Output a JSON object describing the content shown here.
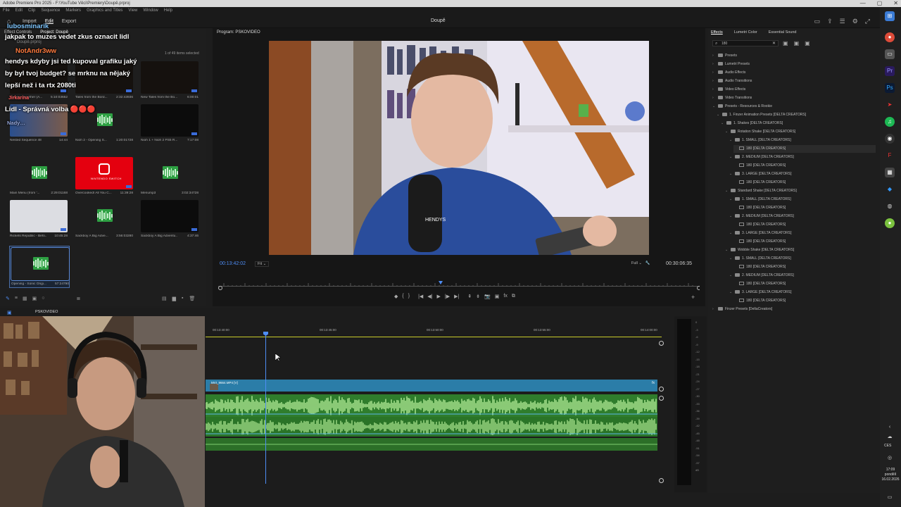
{
  "titlebar": {
    "text": "Adobe Premiere Pro 2025 - F:\\YouTube Věci\\Premiery\\Doupě.prproj",
    "controls": [
      "—",
      "▢",
      "✕"
    ]
  },
  "menubar": [
    "File",
    "Edit",
    "Clip",
    "Sequence",
    "Markers",
    "Graphics and Titles",
    "View",
    "Window",
    "Help"
  ],
  "workspace": {
    "tabs": [
      "Import",
      "Edit",
      "Export"
    ],
    "active_tab": "Edit",
    "project_title": "Doupě"
  },
  "project": {
    "tabs": [
      "Effect Controls",
      "Project: Doupě"
    ],
    "project_name": "Doupě.prproj",
    "items_count": "1 of 49 items selected",
    "clips": [
      {
        "name": "Greater Together (A...",
        "duration": "5:10:03662",
        "kind": "video-dark"
      },
      {
        "name": "Tales from the Bord...",
        "duration": "2:32:43936",
        "kind": "video-dark"
      },
      {
        "name": "New Tales from the Bo...",
        "duration": "6:00:01",
        "kind": "video-dark"
      },
      {
        "name": "Nested Sequence 48",
        "duration": "14:44",
        "kind": "video-person"
      },
      {
        "name": "Nioh 2 - Opening S...",
        "duration": "1:20:01728",
        "kind": "audio"
      },
      {
        "name": "Nioh 1 + Nioh 2 PS5 R...",
        "duration": "7:17:08",
        "kind": "video-dark"
      },
      {
        "name": "Main Menu (from '...",
        "duration": "2:29:01168",
        "kind": "audio"
      },
      {
        "name": "Overcooked! All You C...",
        "duration": "11:39:28",
        "kind": "switch"
      },
      {
        "name": "Menump3",
        "duration": "3:02:34728",
        "kind": "audio"
      },
      {
        "name": "Rickets Republic - Befo...",
        "duration": "10:45:28",
        "kind": "video-light"
      },
      {
        "name": "Sackboy A Big Adve...",
        "duration": "3:56:03280",
        "kind": "audio"
      },
      {
        "name": "Sackboy A Big Adventu...",
        "duration": "4:37:46",
        "kind": "video-dark"
      },
      {
        "name": "Opening - Sonic Origi...",
        "duration": "57:24790",
        "kind": "audio"
      }
    ],
    "switch_label": "NINTENDO SWITCH"
  },
  "chat": [
    {
      "user": "lubosminarik",
      "text": "jakpak to muzes vedet zkus oznacit lidl"
    },
    {
      "user": "NotAndr3ww",
      "text": "hendys kdyby jsi ted kupoval grafiku jaký by byl tvoj budget? se mrknu na nějaký lepší než i ta rtx 2080ti"
    },
    {
      "user": "Jirkarina",
      "text": "Lidl - Správná volba 🔴🔴🔴"
    },
    {
      "user": "Nady",
      "text": ""
    }
  ],
  "program": {
    "title": "Program: PSKOVIDEO",
    "timecode_current": "00:13:42:02",
    "fit": "Fit",
    "quality": "Full",
    "timecode_duration": "00:30:06:35",
    "mic_brand": "HENDYS"
  },
  "effects": {
    "tabs": [
      "Effects",
      "Lumetri Color",
      "Essential Sound"
    ],
    "active_tab": "Effects",
    "search_value": "180",
    "tree": [
      {
        "label": "Presets",
        "depth": 0,
        "type": "folder",
        "arrow": "›"
      },
      {
        "label": "Lumetri Presets",
        "depth": 0,
        "type": "folder",
        "arrow": "›"
      },
      {
        "label": "Audio Effects",
        "depth": 0,
        "type": "folder",
        "arrow": "›"
      },
      {
        "label": "Audio Transitions",
        "depth": 0,
        "type": "folder",
        "arrow": "›"
      },
      {
        "label": "Video Effects",
        "depth": 0,
        "type": "folder",
        "arrow": "›"
      },
      {
        "label": "Video Transitions",
        "depth": 0,
        "type": "folder",
        "arrow": "›"
      },
      {
        "label": "Presets - Resources & Rookie",
        "depth": 0,
        "type": "folder",
        "arrow": "⌄"
      },
      {
        "label": "1. Finzer Animation Presets [DELTA CREATORS]",
        "depth": 1,
        "type": "folder",
        "arrow": "⌄"
      },
      {
        "label": "1. Shakes [DELTA CREATORS]",
        "depth": 2,
        "type": "folder",
        "arrow": "⌄"
      },
      {
        "label": "Rotation Shake [DELTA CREATORS]",
        "depth": 3,
        "type": "folder",
        "arrow": "⌄"
      },
      {
        "label": "1. SMALL [DELTA CREATORS]",
        "depth": 4,
        "type": "folder",
        "arrow": "⌄"
      },
      {
        "label": "180 [DELTA CREATORS]",
        "depth": 5,
        "type": "fx",
        "arrow": "",
        "highlight": true
      },
      {
        "label": "2. MEDIUM [DELTA CREATORS]",
        "depth": 4,
        "type": "folder",
        "arrow": "⌄"
      },
      {
        "label": "180 [DELTA CREATORS]",
        "depth": 5,
        "type": "fx",
        "arrow": ""
      },
      {
        "label": "3. LARGE [DELTA CREATORS]",
        "depth": 4,
        "type": "folder",
        "arrow": "⌄"
      },
      {
        "label": "180 [DELTA CREATORS]",
        "depth": 5,
        "type": "fx",
        "arrow": ""
      },
      {
        "label": "Standard Shake [DELTA CREATORS]",
        "depth": 3,
        "type": "folder",
        "arrow": "⌄"
      },
      {
        "label": "1. SMALL [DELTA CREATORS]",
        "depth": 4,
        "type": "folder",
        "arrow": "⌄"
      },
      {
        "label": "180 [DELTA CREATORS]",
        "depth": 5,
        "type": "fx",
        "arrow": ""
      },
      {
        "label": "2. MEDIUM [DELTA CREATORS]",
        "depth": 4,
        "type": "folder",
        "arrow": "⌄"
      },
      {
        "label": "180 [DELTA CREATORS]",
        "depth": 5,
        "type": "fx",
        "arrow": ""
      },
      {
        "label": "3. LARGE [DELTA CREATORS]",
        "depth": 4,
        "type": "folder",
        "arrow": "⌄"
      },
      {
        "label": "180 [DELTA CREATORS]",
        "depth": 5,
        "type": "fx",
        "arrow": ""
      },
      {
        "label": "Wobble Shake [DELTA CREATORS]",
        "depth": 3,
        "type": "folder",
        "arrow": "⌄"
      },
      {
        "label": "1. SMALL [DELTA CREATORS]",
        "depth": 4,
        "type": "folder",
        "arrow": "⌄"
      },
      {
        "label": "180 [DELTA CREATORS]",
        "depth": 5,
        "type": "fx",
        "arrow": ""
      },
      {
        "label": "2. MEDIUM [DELTA CREATORS]",
        "depth": 4,
        "type": "folder",
        "arrow": "⌄"
      },
      {
        "label": "180 [DELTA CREATORS]",
        "depth": 5,
        "type": "fx",
        "arrow": ""
      },
      {
        "label": "3. LARGE [DELTA CREATORS]",
        "depth": 4,
        "type": "folder",
        "arrow": "⌄"
      },
      {
        "label": "180 [DELTA CREATORS]",
        "depth": 5,
        "type": "fx",
        "arrow": ""
      },
      {
        "label": "Finzer Presets [DeltaCreators]",
        "depth": 0,
        "type": "folder",
        "arrow": "›"
      }
    ]
  },
  "timeline": {
    "sequence_name": "PSKOVIDEO",
    "ruler": [
      "00:13:40:00",
      "00:13:45:00",
      "00:13:50:00",
      "00:13:55:00",
      "00:14:00:00"
    ],
    "video_clip_label": "MVI_9664.MP4 [V]"
  },
  "meter": {
    "scale": [
      "0",
      "-3",
      "-6",
      "-9",
      "-12",
      "-15",
      "-18",
      "-21",
      "-24",
      "-27",
      "-30",
      "-33",
      "-36",
      "-39",
      "-42",
      "-45",
      "-48",
      "-51",
      "-54",
      "-57",
      "dB"
    ]
  },
  "taskbar": {
    "lang": "CES",
    "time": "17:09",
    "day": "pondělí",
    "date": "16.02.2026"
  },
  "colors": {
    "accent_blue": "#4e8df5",
    "audio_green": "#2f7d2c",
    "video_blue": "#2b7da8",
    "chat_name": "#ff7a3d"
  }
}
